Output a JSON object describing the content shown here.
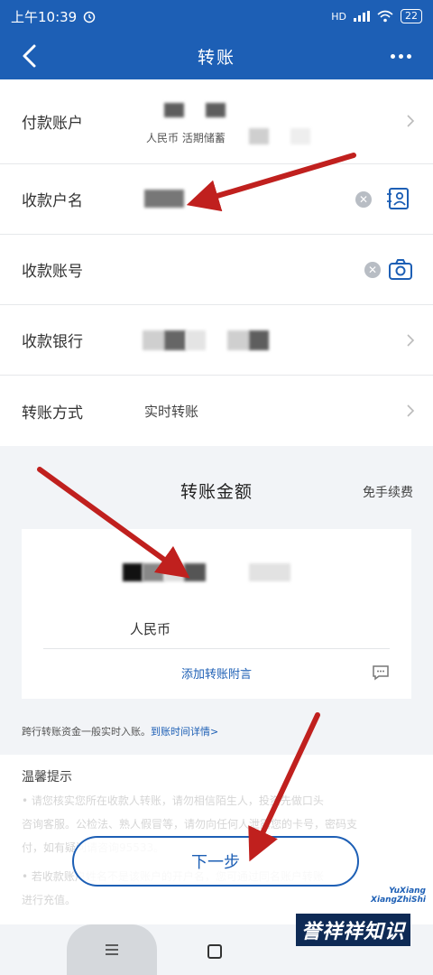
{
  "status_bar": {
    "time": "上午10:39",
    "network": "HD",
    "battery": "22"
  },
  "header": {
    "title": "转账"
  },
  "form": {
    "payer_label": "付款账户",
    "payer_sub": "人民币  活期储蓄",
    "payee_name_label": "收款户名",
    "payee_account_label": "收款账号",
    "payee_bank_label": "收款银行",
    "method_label": "转账方式",
    "method_value": "实时转账"
  },
  "amount": {
    "title": "转账金额",
    "fee_note": "免手续费",
    "currency": "人民币",
    "memo_link": "添加转账附言"
  },
  "notice": {
    "text": "跨行转账资金一般实时入账。",
    "link": "到账时间详情>"
  },
  "tips": {
    "title": "温馨提示",
    "lines": [
      "• 请您核实您所在收款人转账，请勿相信陌生人，投资先做口头",
      "咨询客服。公检法、熟人假冒等，请勿向任何人泄露您的卡号，密码支",
      "付，如有疑问请咨询95533。",
      "• 若收款账户姓名不是该账户的开户名，您可通过同名账户转账",
      "进行充值。"
    ]
  },
  "buttons": {
    "next": "下一步"
  },
  "watermark": {
    "top_line1": "YuXiang",
    "top_line2": "XiangZhiShi",
    "text": "誉祥祥知识"
  },
  "colors": {
    "brand": "#1d5fb5",
    "arrow": "#c0201e"
  }
}
